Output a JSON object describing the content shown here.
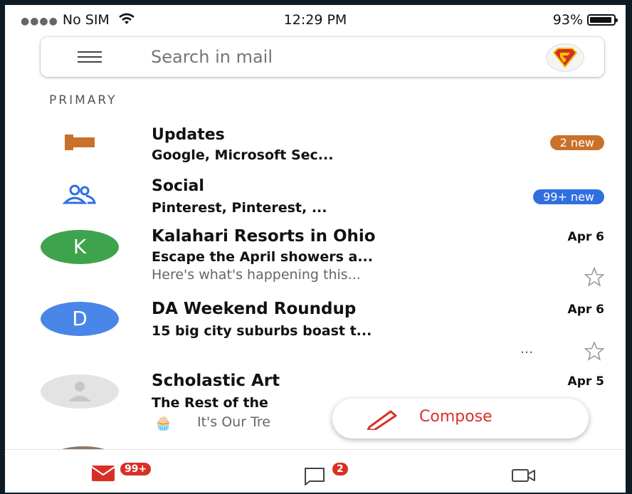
{
  "status_bar": {
    "carrier": "No SIM",
    "time": "12:29 PM",
    "battery": "93%",
    "battery_level": 0.93
  },
  "search": {
    "placeholder": "Search in mail"
  },
  "section_label": "PRIMARY",
  "categories": [
    {
      "title": "Updates",
      "subtitle": "Google, Microsoft Sec...",
      "badge": "2 new",
      "badge_color": "#c9712a",
      "icon": "label-flag-icon"
    },
    {
      "title": "Social",
      "subtitle": "Pinterest, Pinterest, ...",
      "badge": "99+ new",
      "badge_color": "#2f6fe0",
      "icon": "people-icon"
    }
  ],
  "emails": [
    {
      "avatar_letter": "K",
      "avatar_color": "#3fa34d",
      "sender": "Kalahari Resorts in Ohio",
      "date": "Apr 6",
      "subject": "Escape the April showers a...",
      "snippet": "Here's what's happening this..."
    },
    {
      "avatar_letter": "D",
      "avatar_color": "#4a86e8",
      "sender": "DA Weekend Roundup",
      "date": "Apr 6",
      "subject": "15 big city suburbs boast t...",
      "snippet": "..."
    },
    {
      "avatar_letter": "",
      "avatar_color": "#e3e3e3",
      "sender": "Scholastic Art",
      "date": "Apr 5",
      "subject": "The Rest of the",
      "snippet": "It's Our Tre"
    }
  ],
  "compose": {
    "label": "Compose"
  },
  "bottom_nav": {
    "mail_badge": "99+",
    "chat_badge": "2"
  },
  "colors": {
    "accent_red": "#d93025"
  }
}
